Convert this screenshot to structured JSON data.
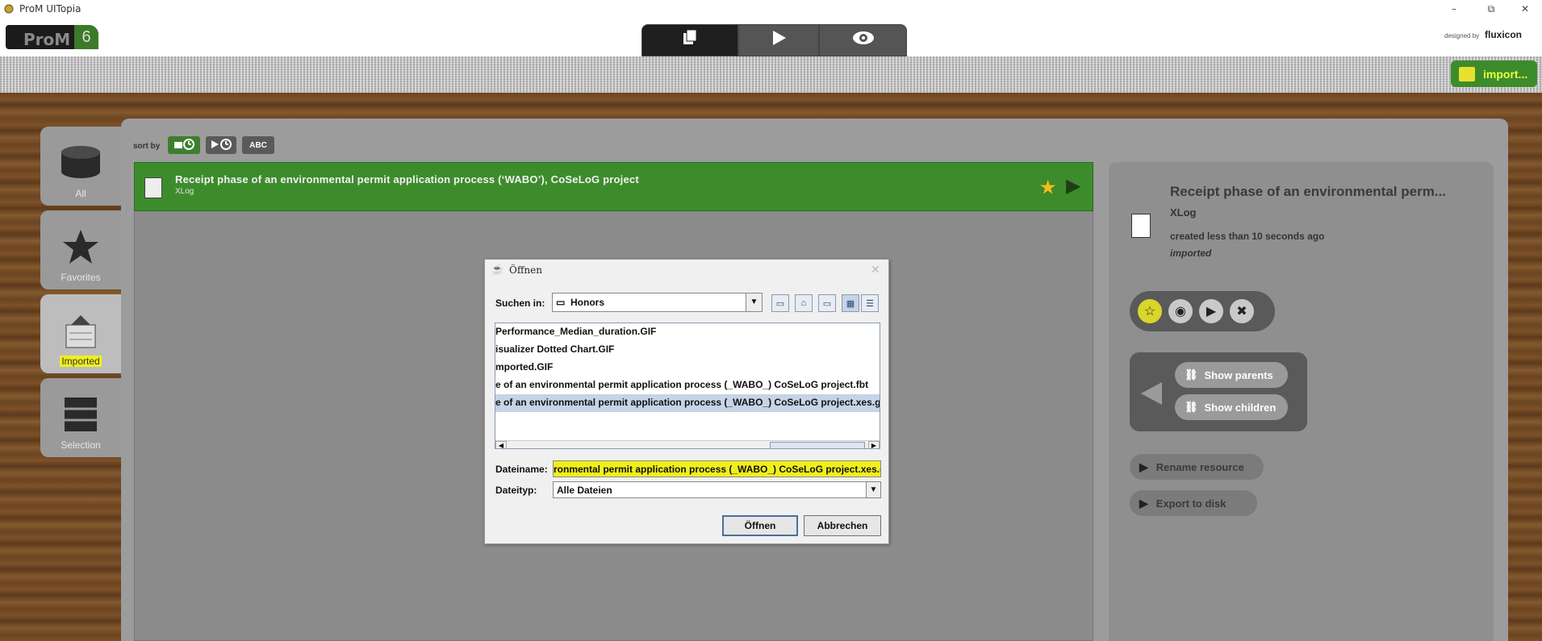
{
  "window": {
    "title": "ProM UITopia",
    "minimize": "–",
    "maximize": "⧉",
    "close": "✕"
  },
  "header": {
    "logo_text": "ProM",
    "logo_version": "6",
    "designed_by": "designed by",
    "brand": "fluxicon",
    "import_label": "import..."
  },
  "nav": {
    "items": [
      {
        "label": "All"
      },
      {
        "label": "Favorites"
      },
      {
        "label": "Imported"
      },
      {
        "label": "Selection"
      }
    ]
  },
  "sort": {
    "label": "sort by",
    "abc": "ABC"
  },
  "resource": {
    "title": "Receipt phase of an environmental permit application process (‘WABO’), CoSeLoG project",
    "type": "XLog"
  },
  "info": {
    "title": "Receipt phase of an environmental perm...",
    "type": "XLog",
    "created": "created less than 10 seconds ago",
    "status": "imported",
    "show_parents": "Show parents",
    "show_children": "Show children",
    "rename": "Rename resource",
    "export": "Export to disk"
  },
  "dialog": {
    "title": "Öffnen",
    "look_in_label": "Suchen in:",
    "look_in_value": "Honors",
    "files": [
      "Performance_Median_duration.GIF",
      "isualizer Dotted Chart.GIF",
      "mported.GIF",
      "e of an environmental permit application process (_WABO_) CoSeLoG project.fbt",
      "e of an environmental permit application process (_WABO_) CoSeLoG project.xes.gz"
    ],
    "selected_index": 4,
    "filename_label": "Dateiname:",
    "filename_value": "ronmental permit application process (_WABO_) CoSeLoG project.xes.gz",
    "filetype_label": "Dateityp:",
    "filetype_value": "Alle Dateien",
    "open_label": "Öffnen",
    "cancel_label": "Abbrechen"
  },
  "colors": {
    "accent_green": "#3d8c2c",
    "highlight_yellow": "#f0ef1c"
  }
}
